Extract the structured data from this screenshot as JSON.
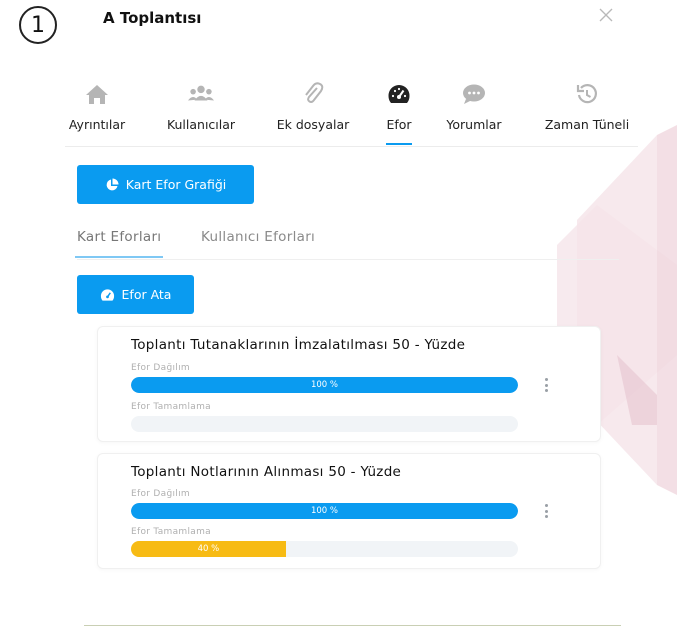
{
  "step_number": "1",
  "modal": {
    "title": "A Toplantısı"
  },
  "tabs": [
    {
      "label": "Ayrıntılar",
      "icon": "home-icon"
    },
    {
      "label": "Kullanıcılar",
      "icon": "users-icon"
    },
    {
      "label": "Ek dosyalar",
      "icon": "paperclip-icon"
    },
    {
      "label": "Efor",
      "icon": "gauge-icon",
      "active": true
    },
    {
      "label": "Yorumlar",
      "icon": "comment-icon"
    },
    {
      "label": "Zaman Tüneli",
      "icon": "history-icon"
    }
  ],
  "actions": {
    "chart_button": "Kart Efor Grafiği",
    "assign_button": "Efor Ata"
  },
  "subtabs": [
    {
      "label": "Kart Eforları",
      "active": true
    },
    {
      "label": "Kullanıcı Eforları"
    }
  ],
  "cards": [
    {
      "title": "Toplantı Tutanaklarının İmzalatılması 50 - Yüzde",
      "distribution_label": "Efor Dağılım",
      "distribution_value": 100,
      "distribution_text": "100 %",
      "completion_label": "Efor Tamamlama",
      "completion_value": 0,
      "completion_text": ""
    },
    {
      "title": "Toplantı Notlarının Alınması 50 - Yüzde",
      "distribution_label": "Efor Dağılım",
      "distribution_value": 100,
      "distribution_text": "100 %",
      "completion_label": "Efor Tamamlama",
      "completion_value": 40,
      "completion_text": "40 %"
    }
  ],
  "colors": {
    "accent": "#0a9bf0",
    "completion": "#f7bb14",
    "track": "#f1f4f7",
    "deco": "#f3dfe5"
  }
}
